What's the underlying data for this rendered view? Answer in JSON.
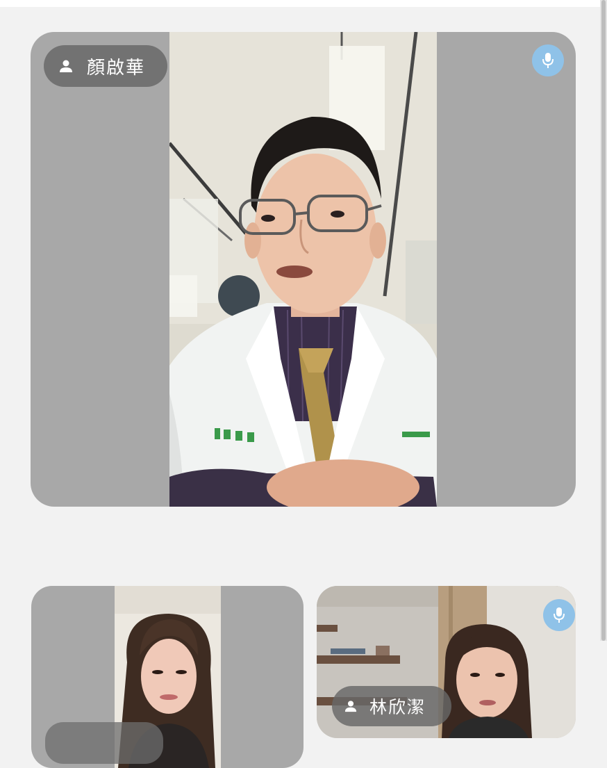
{
  "participants": [
    {
      "name": "顏啟華",
      "mic": "mic-icon",
      "person_icon": "person-icon"
    },
    {
      "name": "",
      "mic": "",
      "person_icon": ""
    },
    {
      "name": "林欣潔",
      "mic": "mic-icon",
      "person_icon": "person-icon"
    }
  ],
  "colors": {
    "background": "#f2f2f2",
    "tile": "#a8a8a8",
    "mic_active": "#8fc2e8",
    "name_pill": "#686868"
  }
}
